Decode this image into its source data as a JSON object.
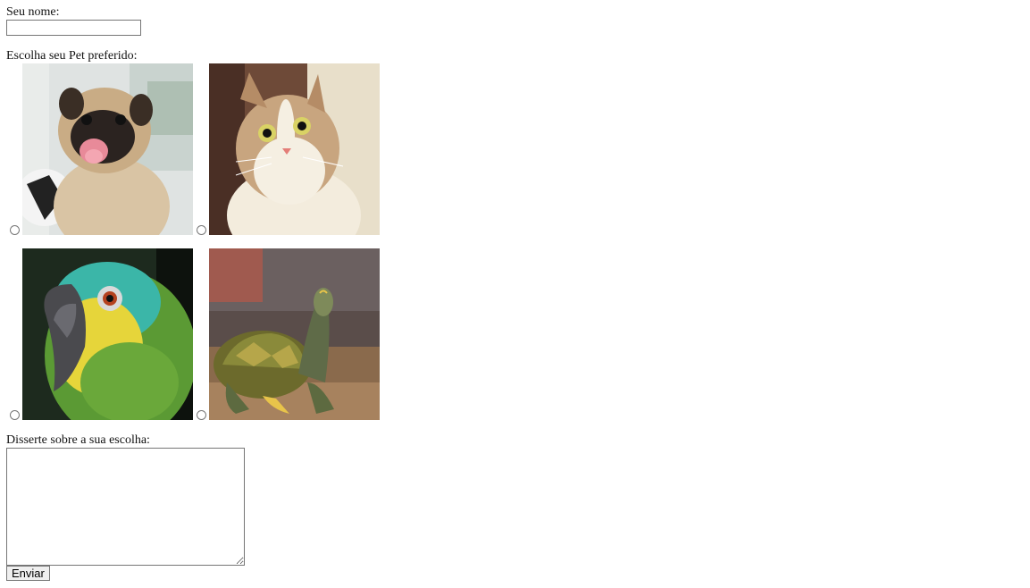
{
  "form": {
    "name_label": "Seu nome:",
    "name_value": "",
    "pet_label": "Escolha seu Pet preferido:",
    "pets": [
      {
        "name": "dog",
        "selected": false
      },
      {
        "name": "cat",
        "selected": false
      },
      {
        "name": "parrot",
        "selected": false
      },
      {
        "name": "turtle",
        "selected": false
      }
    ],
    "essay_label": "Disserte sobre a sua escolha:",
    "essay_value": "",
    "submit_label": "Enviar"
  }
}
